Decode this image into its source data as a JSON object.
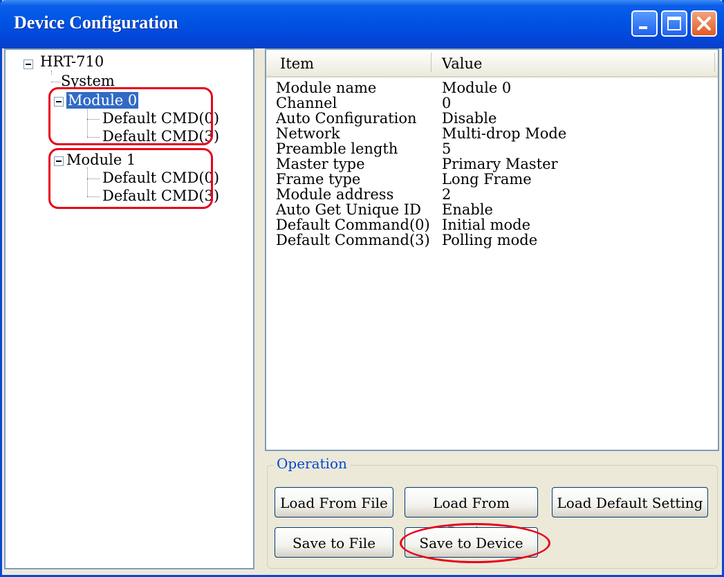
{
  "window": {
    "title": "Device Configuration"
  },
  "tree": {
    "root": "HRT-710",
    "system": "System",
    "module0": "Module 0",
    "module0_cmd0": "Default CMD(0)",
    "module0_cmd3": "Default CMD(3)",
    "module1": "Module 1",
    "module1_cmd0": "Default CMD(0)",
    "module1_cmd3": "Default CMD(3)"
  },
  "list": {
    "columns": [
      "Item",
      "Value"
    ],
    "rows": [
      {
        "item": "Module name",
        "value": "Module 0"
      },
      {
        "item": "Channel",
        "value": "0"
      },
      {
        "item": "Auto Configuration",
        "value": "Disable"
      },
      {
        "item": "Network",
        "value": "Multi-drop Mode"
      },
      {
        "item": "Preamble length",
        "value": "5"
      },
      {
        "item": "Master type",
        "value": "Primary Master"
      },
      {
        "item": "Frame type",
        "value": "Long Frame"
      },
      {
        "item": "Module address",
        "value": "2"
      },
      {
        "item": "Auto Get Unique ID",
        "value": "Enable"
      },
      {
        "item": "Default Command(0)",
        "value": "Initial mode"
      },
      {
        "item": "Default Command(3)",
        "value": "Polling mode"
      }
    ]
  },
  "operation": {
    "title": "Operation",
    "load_file": "Load From File",
    "load_device": "Load From Device",
    "load_default": "Load Default Setting",
    "save_file": "Save to File",
    "save_device": "Save to Device"
  },
  "colors": {
    "highlight": "#e8001a",
    "selection": "#316ac5",
    "titlebar": "#0055e5"
  }
}
